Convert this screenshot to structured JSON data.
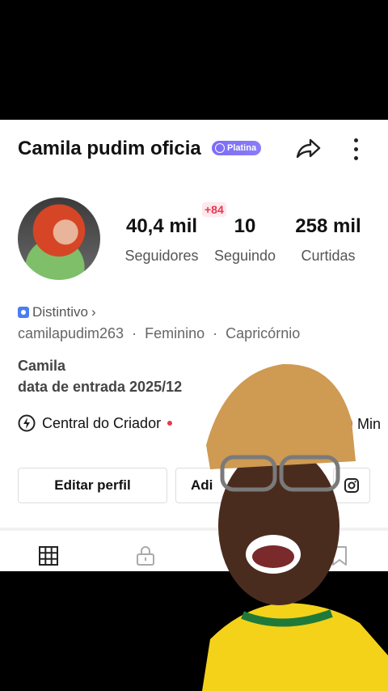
{
  "profile": {
    "display_name": "Camila pudim oficia",
    "badge_label": "Platina",
    "username": "camilapudim263",
    "meta_sep1": "·",
    "gender": "Feminino",
    "meta_sep2": "·",
    "sign": "Capricórnio",
    "bio_name": "Camila",
    "joined": "data de entrada 2025/12",
    "distintivo_label": "Distintivo",
    "distintivo_chevron": "›"
  },
  "stats": [
    {
      "value": "40,4 mil",
      "label": "Seguidores"
    },
    {
      "value": "10",
      "label": "Seguindo"
    },
    {
      "value": "258 mil",
      "label": "Curtidas"
    }
  ],
  "notification_badge": "+84",
  "creator_center": {
    "label": "Central do Criador"
  },
  "mini_item": {
    "label": "Min"
  },
  "buttons": {
    "edit_profile": "Editar perfil",
    "add": "Adi"
  },
  "icons": {
    "share": "share-arrow-icon",
    "more": "more-vertical-icon",
    "grid": "grid-icon",
    "lock": "lock-icon",
    "bookmark": "bookmark-icon",
    "instagram": "instagram-icon",
    "bolt": "lightning-icon",
    "badge_shield": "shield-icon"
  },
  "colors": {
    "badge": "#7c6cf6",
    "red": "#e8384f"
  }
}
